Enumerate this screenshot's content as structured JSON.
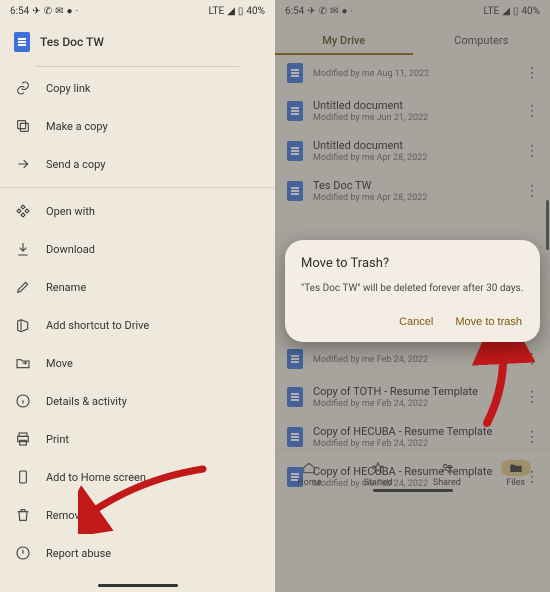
{
  "status": {
    "time": "6:54",
    "lte": "LTE",
    "battery": "40%"
  },
  "left": {
    "doc_title": "Tes Doc TW",
    "menu": {
      "copy_link": "Copy link",
      "make_copy": "Make a copy",
      "send_copy": "Send a copy",
      "open_with": "Open with",
      "download": "Download",
      "rename": "Rename",
      "add_shortcut": "Add shortcut to Drive",
      "move": "Move",
      "details": "Details & activity",
      "print": "Print",
      "home_screen": "Add to Home screen",
      "remove": "Remove",
      "report": "Report abuse"
    }
  },
  "right": {
    "tabs": {
      "my_drive": "My Drive",
      "computers": "Computers"
    },
    "files": [
      {
        "name": "",
        "sub": "Modified by me Aug 11, 2022"
      },
      {
        "name": "Untitled document",
        "sub": "Modified by me Jun 21, 2022"
      },
      {
        "name": "Untitled document",
        "sub": "Modified by me Apr 28, 2022"
      },
      {
        "name": "Tes Doc TW",
        "sub": "Modified by me Apr 28, 2022"
      },
      {
        "name": "",
        "sub": "Modified by me Feb 24, 2022"
      },
      {
        "name": "Copy of TOTH - Resume Template",
        "sub": "Modified by me Feb 24, 2022"
      },
      {
        "name": "Copy of HECUBA - Resume Template",
        "sub": "Modified by me Feb 24, 2022"
      },
      {
        "name": "Copy of HECUBA - Resume Template",
        "sub": "Modified by me Feb 24, 2022"
      }
    ],
    "dialog": {
      "title": "Move to Trash?",
      "body": "\"Tes Doc TW\" will be deleted forever after 30 days.",
      "cancel": "Cancel",
      "confirm": "Move to trash"
    },
    "nav": {
      "home": "Home",
      "starred": "Starred",
      "shared": "Shared",
      "files": "Files"
    }
  }
}
